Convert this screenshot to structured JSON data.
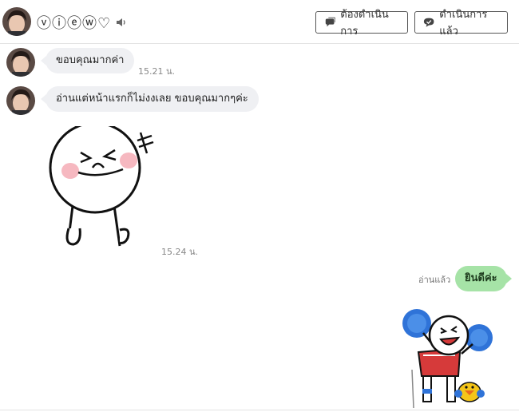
{
  "header": {
    "contact_name": "ⓥⓘⓔⓦ♡",
    "btn_todo_label": "ต้องดำเนินการ",
    "btn_done_label": "ดำเนินการแล้ว"
  },
  "messages": [
    {
      "text": "ขอบคุณมากค่า",
      "time": "15.21 น."
    },
    {
      "text": "อ่านแต่หน้าแรกก็ไม่งงเลย ขอบคุณมากๆค่ะ"
    },
    {
      "sticker": "moon-laughing-sticker",
      "time": "15.24 น."
    }
  ],
  "outgoing": {
    "read_label": "อ่านแล้ว",
    "text": "ยินดีค่ะ",
    "sticker": "moon-cheerleader-sticker"
  },
  "colors": {
    "incoming_bubble": "#eff0f3",
    "outgoing_bubble": "#a6e3a7"
  }
}
